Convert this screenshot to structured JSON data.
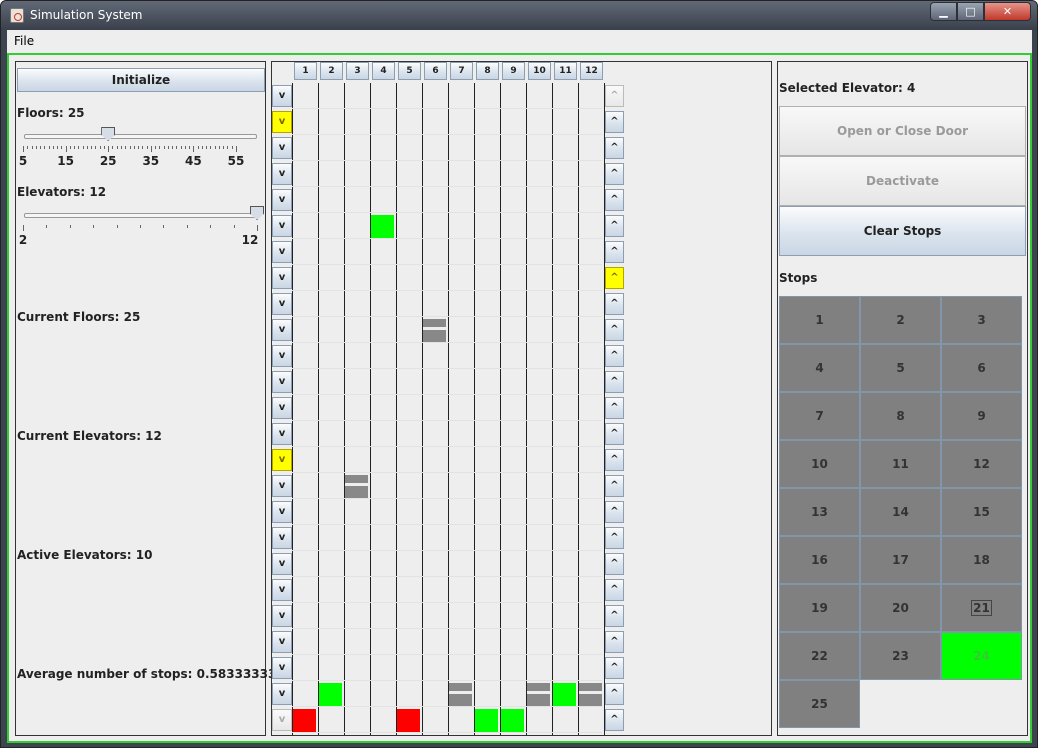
{
  "window": {
    "title": "Simulation System",
    "min_glyph": "▁",
    "max_glyph": "□",
    "close_glyph": "✕"
  },
  "menu": {
    "file": "File"
  },
  "left": {
    "initialize": "Initialize",
    "floors_label": "Floors: 25",
    "floors_ticks": [
      "5",
      "15",
      "25",
      "35",
      "45",
      "55"
    ],
    "floors_value": 25,
    "elevators_label": "Elevators: 12",
    "elevators_ticks": [
      "2",
      "12"
    ],
    "elevators_value": 12,
    "current_floors": "Current Floors: 25",
    "current_elevators": "Current Elevators: 12",
    "active_elevators": "Active Elevators: 10",
    "avg_stops": "Average number of stops: 0.58333333333..."
  },
  "grid": {
    "columns": [
      "1",
      "2",
      "3",
      "4",
      "5",
      "6",
      "7",
      "8",
      "9",
      "10",
      "11",
      "12"
    ],
    "floors": 25,
    "down_glyph": "v",
    "up_glyph": "^",
    "down_highlight_rows": [
      2,
      15
    ],
    "down_disabled_rows": [
      25
    ],
    "up_highlight_rows": [
      8
    ],
    "up_disabled_rows": [
      1
    ],
    "elevators": [
      {
        "col": 1,
        "row": 25,
        "state": "red"
      },
      {
        "col": 2,
        "row": 24,
        "state": "green"
      },
      {
        "col": 3,
        "row": 16,
        "state": "gray"
      },
      {
        "col": 4,
        "row": 6,
        "state": "green"
      },
      {
        "col": 5,
        "row": 25,
        "state": "red"
      },
      {
        "col": 6,
        "row": 10,
        "state": "gray"
      },
      {
        "col": 7,
        "row": 24,
        "state": "gray"
      },
      {
        "col": 8,
        "row": 25,
        "state": "green"
      },
      {
        "col": 9,
        "row": 25,
        "state": "green"
      },
      {
        "col": 10,
        "row": 24,
        "state": "gray"
      },
      {
        "col": 11,
        "row": 24,
        "state": "green"
      },
      {
        "col": 12,
        "row": 24,
        "state": "gray"
      }
    ],
    "colors": {
      "green": "#00ff00",
      "red": "#ff0000",
      "gray": "#888888",
      "yellow": "#ffff00"
    }
  },
  "right": {
    "selected": "Selected Elevator: 4",
    "open_close": "Open or Close Door",
    "deactivate": "Deactivate",
    "clear_stops": "Clear Stops",
    "stops_label": "Stops",
    "stops": [
      "1",
      "2",
      "3",
      "4",
      "5",
      "6",
      "7",
      "8",
      "9",
      "10",
      "11",
      "12",
      "13",
      "14",
      "15",
      "16",
      "17",
      "18",
      "19",
      "20",
      "21",
      "22",
      "23",
      "24",
      "25"
    ],
    "active_stop": "24",
    "focused_stop": "21"
  }
}
